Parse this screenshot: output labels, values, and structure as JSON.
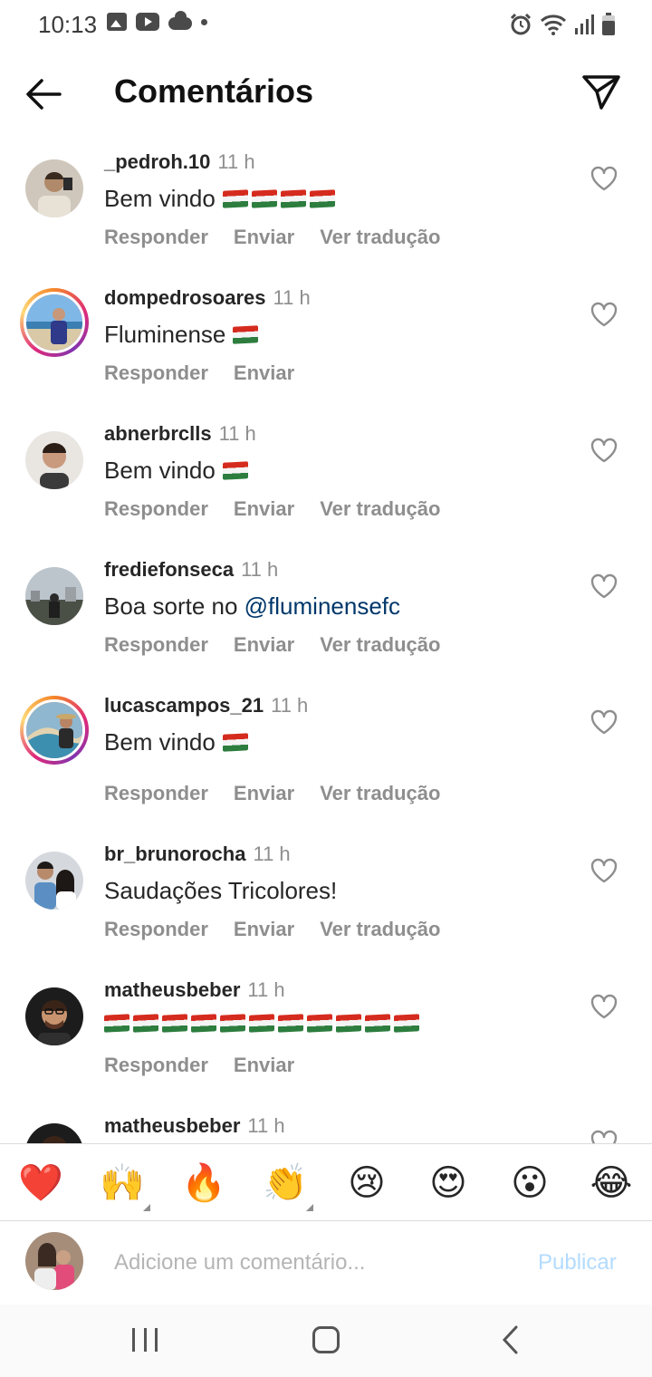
{
  "status_bar": {
    "time": "10:13",
    "left_icons": [
      "gallery-icon",
      "youtube-icon",
      "cloud-icon",
      "dot-icon"
    ],
    "right_icons": [
      "alarm-icon",
      "wifi-icon",
      "signal-icon",
      "battery-icon"
    ]
  },
  "header": {
    "title": "Comentários",
    "back_icon": "arrow-left-icon",
    "send_icon": "paper-plane-icon"
  },
  "comments": [
    {
      "username": "_pedroh.10",
      "time": "11 h",
      "text": "Bem vindo",
      "flags": 4,
      "actions": [
        "Responder",
        "Enviar",
        "Ver tradução"
      ],
      "story_ring": false
    },
    {
      "username": "dompedrosoares",
      "time": "11 h",
      "text": "Fluminense",
      "flags": 1,
      "actions": [
        "Responder",
        "Enviar"
      ],
      "story_ring": true
    },
    {
      "username": "abnerbrclls",
      "time": "11 h",
      "text": "Bem vindo",
      "flags": 1,
      "actions": [
        "Responder",
        "Enviar",
        "Ver tradução"
      ],
      "story_ring": false
    },
    {
      "username": "frediefonseca",
      "time": "11 h",
      "text": "Boa sorte no ",
      "mention": "@fluminensefc",
      "flags": 0,
      "actions": [
        "Responder",
        "Enviar",
        "Ver tradução"
      ],
      "story_ring": false
    },
    {
      "username": "lucascampos_21",
      "time": "11 h",
      "text": "Bem vindo",
      "flags": 1,
      "actions": [
        "Responder",
        "Enviar",
        "Ver tradução"
      ],
      "story_ring": true
    },
    {
      "username": "br_brunorocha",
      "time": "11 h",
      "text": "Saudações Tricolores!",
      "flags": 0,
      "actions": [
        "Responder",
        "Enviar",
        "Ver tradução"
      ],
      "story_ring": false
    },
    {
      "username": "matheusbeber",
      "time": "11 h",
      "text": "",
      "flags": 11,
      "actions": [
        "Responder",
        "Enviar"
      ],
      "story_ring": false
    },
    {
      "username": "matheusbeber",
      "time": "11 h",
      "text": "",
      "flags": 0,
      "actions": [],
      "story_ring": false
    }
  ],
  "emoji_bar": [
    "❤️",
    "🙌",
    "🔥",
    "👏",
    "😢",
    "😍",
    "😮",
    "😂"
  ],
  "comment_input": {
    "placeholder": "Adicione um comentário...",
    "publish_label": "Publicar"
  },
  "colors": {
    "mention": "#00376b",
    "publish_disabled": "#b3dbff",
    "secondary_text": "#8e8e8e"
  }
}
